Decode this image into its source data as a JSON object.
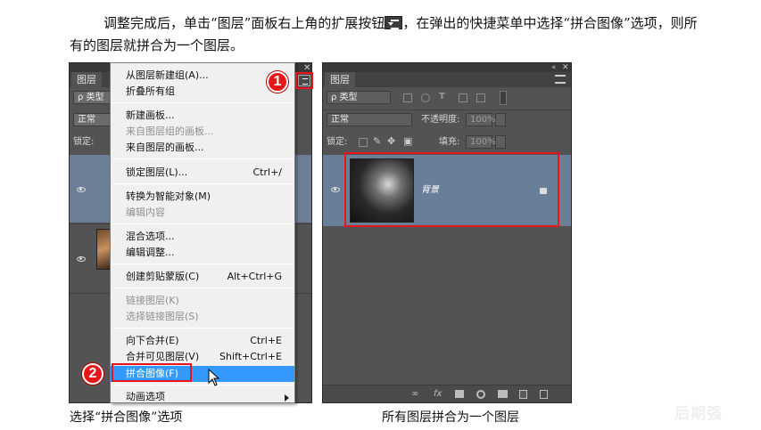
{
  "paragraph": {
    "part1": "调整完成后，单击“图层”面板右上角的扩展按钮",
    "part2": "，在弹出的快捷菜单中选择“拼合图像”选项，则所有的图层就拼合为一个图层。"
  },
  "left_panel": {
    "tab": "图层",
    "kind_label": "ρ 类型",
    "blend_mode": "正常",
    "lock_label": "锁定:"
  },
  "context_menu": {
    "items": [
      {
        "label": "从图层新建组(A)...",
        "shortcut": "",
        "disabled": false
      },
      {
        "label": "折叠所有组",
        "shortcut": "",
        "disabled": false
      },
      {
        "label": "新建画板...",
        "shortcut": "",
        "disabled": false
      },
      {
        "label": "来自图层组的画板...",
        "shortcut": "",
        "disabled": true
      },
      {
        "label": "来自图层的画板...",
        "shortcut": "",
        "disabled": false
      },
      {
        "label": "锁定图层(L)...",
        "shortcut": "Ctrl+/",
        "disabled": false
      },
      {
        "label": "转换为智能对象(M)",
        "shortcut": "",
        "disabled": false
      },
      {
        "label": "编辑内容",
        "shortcut": "",
        "disabled": true
      },
      {
        "label": "混合选项...",
        "shortcut": "",
        "disabled": false
      },
      {
        "label": "编辑调整...",
        "shortcut": "",
        "disabled": false
      },
      {
        "label": "创建剪贴蒙版(C)",
        "shortcut": "Alt+Ctrl+G",
        "disabled": false
      },
      {
        "label": "链接图层(K)",
        "shortcut": "",
        "disabled": true
      },
      {
        "label": "选择链接图层(S)",
        "shortcut": "",
        "disabled": true
      },
      {
        "label": "向下合并(E)",
        "shortcut": "Ctrl+E",
        "disabled": false
      },
      {
        "label": "合并可见图层(V)",
        "shortcut": "Shift+Ctrl+E",
        "disabled": false
      },
      {
        "label": "拼合图像(F)",
        "shortcut": "",
        "disabled": false,
        "highlighted": true
      },
      {
        "label": "动画选项",
        "shortcut": "",
        "disabled": false,
        "submenu": true
      }
    ]
  },
  "callouts": {
    "one": "1",
    "two": "2"
  },
  "right_panel": {
    "tab": "图层",
    "kind_label": "ρ 类型",
    "blend_mode": "正常",
    "opacity_label": "不透明度:",
    "opacity_value": "100%",
    "lock_label": "锁定:",
    "fill_label": "填充:",
    "fill_value": "100%",
    "layer_name": "背景"
  },
  "captions": {
    "left": "选择“拼合图像”选项",
    "right": "所有图层拼合为一个图层"
  },
  "watermark": "后期强"
}
